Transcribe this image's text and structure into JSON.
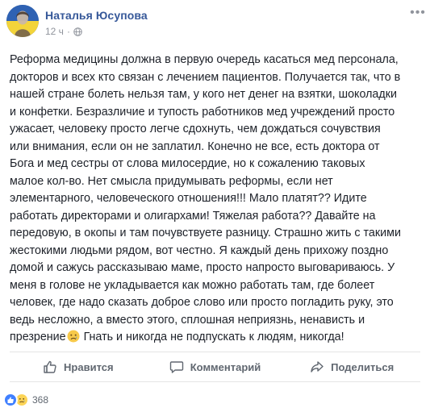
{
  "post": {
    "author": "Наталья Юсупова",
    "time": "12 ч",
    "time_separator": "·",
    "menu_glyph": "•••",
    "text_lines": [
      "Реформа медицины должна в первую очередь касаться мед персонала,",
      "докторов и всех кто связан с лечением пациентов. Получается так, что в",
      "нашей стране болеть нельзя там, у кого нет денег на взятки, шоколадки",
      "и конфетки. Безразличие и тупость работников мед учреждений просто",
      "ужасает, человеку просто легче сдохнуть, чем дождаться сочувствия",
      "или внимания, если он не заплатил. Конечно не все, есть доктора от",
      "Бога и мед сестры от слова милосердие, но к сожалению таковых",
      "малое кол-во. Нет смысла придумывать реформы, если нет",
      "элементарного, человеческого отношения!!! Мало платят?? Идите",
      "работать директорами и олигархами! Тяжелая работа?? Давайте на",
      "передовую, в окопы и там почувствуете разницу. Страшно жить с такими",
      "жестокими людьми рядом, вот честно. Я каждый день прихожу поздно",
      "домой и сажусь рассказываю маме, просто напросто выговариваюсь. У",
      "меня в голове не укладывается как можно работать там, где болеет",
      "человек, где надо сказать доброе слово или просто погладить руку, это",
      "ведь несложно, а вместо этого, сплошная неприязнь, ненависть и"
    ],
    "last_line_before_emoji": "презрение",
    "last_line_after_emoji": " Гнать и никогда не подпускать к людям, никогда!"
  },
  "actions": {
    "like": "Нравится",
    "comment": "Комментарий",
    "share": "Поделиться"
  },
  "reactions": {
    "count": "368"
  },
  "colors": {
    "author": "#365899",
    "meta": "#90949c",
    "action_text": "#606770",
    "like_blue": "#4080ff",
    "sad_yellow": "#fcd456"
  },
  "icons": {
    "globe": "globe-icon",
    "like": "thumbs-up-icon",
    "comment": "speech-bubble-icon",
    "share": "share-arrow-icon",
    "emoji": "sad-face-emoji"
  }
}
